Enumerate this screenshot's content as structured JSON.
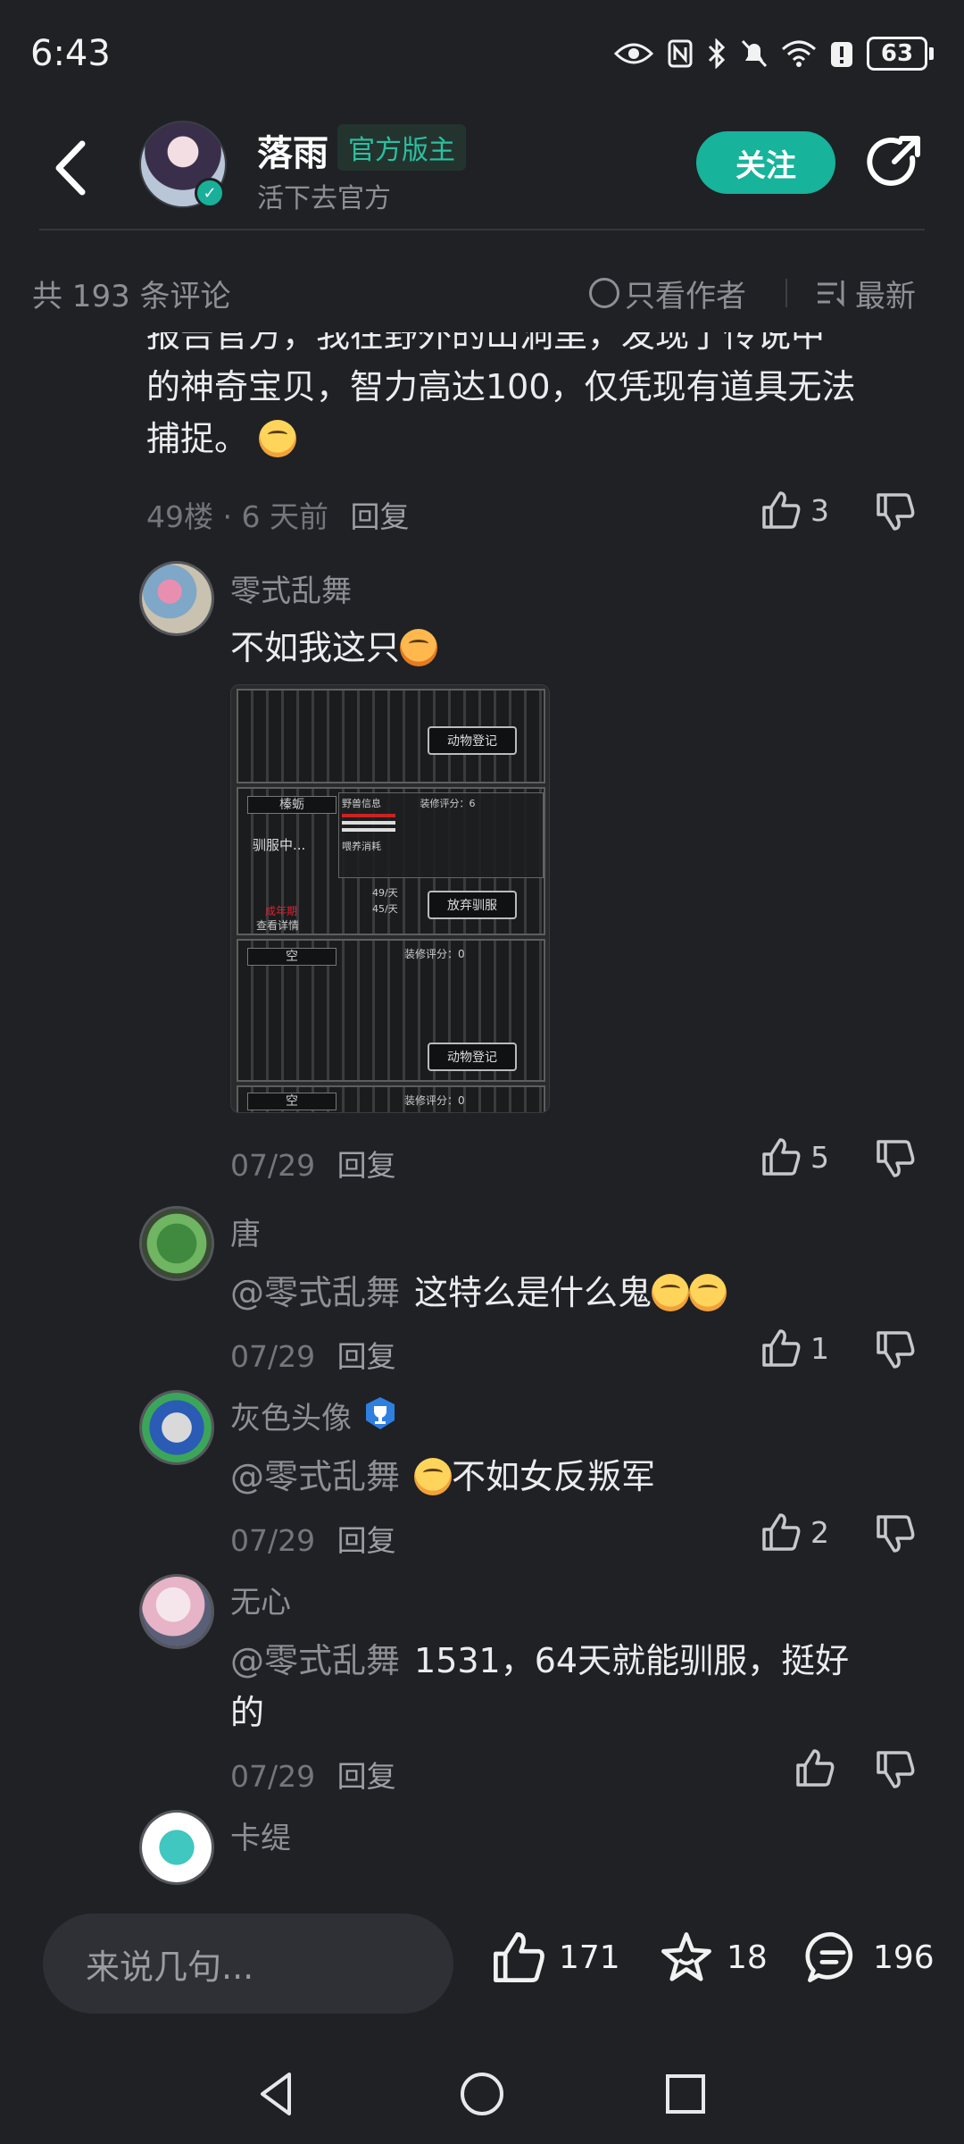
{
  "status_bar": {
    "time": "6:43",
    "battery": "63"
  },
  "header": {
    "author_name": "落雨",
    "author_tag": "官方版主",
    "author_subtitle": "活下去官方",
    "follow_label": "关注"
  },
  "filter_bar": {
    "comment_count": "共 193 条评论",
    "author_only_label": "只看作者",
    "sort_label": "最新"
  },
  "main_comment": {
    "text_partial": "报告官方，我在野外的山洞里，发现了传说中",
    "text_lines": [
      "的神奇宝贝，智力高达100，仅凭现有道具无法",
      "捕捉。"
    ],
    "floor": "49楼",
    "time": "· 6 天前",
    "reply_label": "回复",
    "likes": "3"
  },
  "replies": [
    {
      "name": "零式乱舞",
      "text": "不如我这只",
      "date": "07/29",
      "reply_label": "回复",
      "likes": "5",
      "image": {
        "labels": {
          "cage1_btn": "动物登记",
          "cage2_title": "榛蛎",
          "cage2_status": "驯服中...",
          "cage2_period": "成年期",
          "cage2_detail": "查看详情",
          "cage2_btn": "放弃驯服",
          "cage2_info": "野兽信息",
          "cage2_score": "装修评分：6",
          "cage2_feed": "喂养消耗",
          "cage2_feed1": "49/天",
          "cage2_feed2": "45/天",
          "cage3_title": "空",
          "cage3_score": "装修评分：0",
          "cage3_btn": "动物登记",
          "cage4_title": "空",
          "cage4_score": "装修评分：0"
        }
      }
    },
    {
      "name": "唐",
      "mention": "@零式乱舞",
      "text": "这特么是什么鬼",
      "date": "07/29",
      "reply_label": "回复",
      "likes": "1"
    },
    {
      "name": "灰色头像",
      "mention": "@零式乱舞",
      "text": "不如女反叛军",
      "date": "07/29",
      "reply_label": "回复",
      "likes": "2"
    },
    {
      "name": "无心",
      "mention": "@零式乱舞",
      "text": "1531，64天就能驯服，挺好",
      "text_line2": "的",
      "date": "07/29",
      "reply_label": "回复",
      "likes": ""
    },
    {
      "name": "卡缇"
    }
  ],
  "bottom_bar": {
    "input_placeholder": "来说几句...",
    "like_count": "171",
    "favorite_count": "18",
    "comment_count": "196"
  },
  "colors": {
    "accent": "#17b39a",
    "background": "#1f2125"
  }
}
